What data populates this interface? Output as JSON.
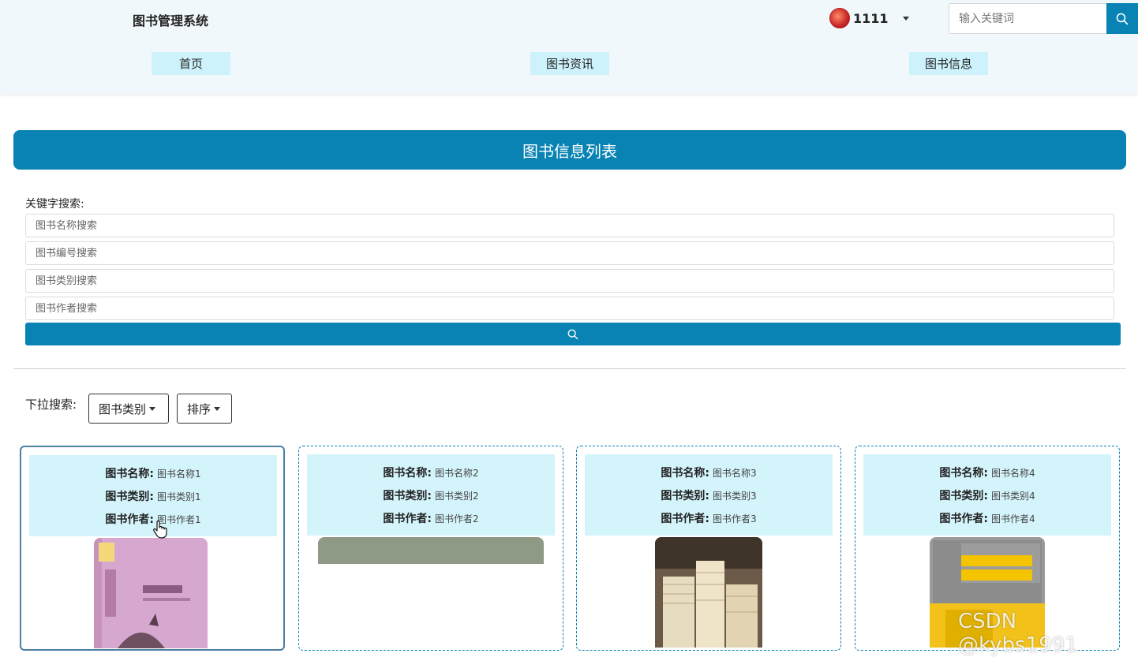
{
  "header": {
    "site_title": "图书管理系统",
    "username": "1111",
    "search_placeholder": "输入关键词",
    "nav": [
      "首页",
      "图书资讯",
      "图书信息"
    ]
  },
  "page": {
    "banner_title": "图书信息列表",
    "keyword_label": "关键字搜索:",
    "filters": {
      "name_placeholder": "图书名称搜索",
      "code_placeholder": "图书编号搜索",
      "category_placeholder": "图书类别搜索",
      "author_placeholder": "图书作者搜索"
    },
    "dropdown_label": "下拉搜索:",
    "dropdowns": [
      "图书类别",
      "排序"
    ]
  },
  "cards": [
    {
      "name_label": "图书名称:",
      "name": "图书名称1",
      "category_label": "图书类别:",
      "category": "图书类别1",
      "author_label": "图书作者:",
      "author": "图书作者1"
    },
    {
      "name_label": "图书名称:",
      "name": "图书名称2",
      "category_label": "图书类别:",
      "category": "图书类别2",
      "author_label": "图书作者:",
      "author": "图书作者2"
    },
    {
      "name_label": "图书名称:",
      "name": "图书名称3",
      "category_label": "图书类别:",
      "category": "图书类别3",
      "author_label": "图书作者:",
      "author": "图书作者3"
    },
    {
      "name_label": "图书名称:",
      "name": "图书名称4",
      "category_label": "图书类别:",
      "category": "图书类别4",
      "author_label": "图书作者:",
      "author": "图书作者4"
    }
  ],
  "watermark": "CSDN @kybs1991",
  "colors": {
    "primary": "#0883b4",
    "nav_bg": "#cdf2fb",
    "card_info_bg": "#d4f4fc",
    "header_bg": "#f1f8fc"
  }
}
